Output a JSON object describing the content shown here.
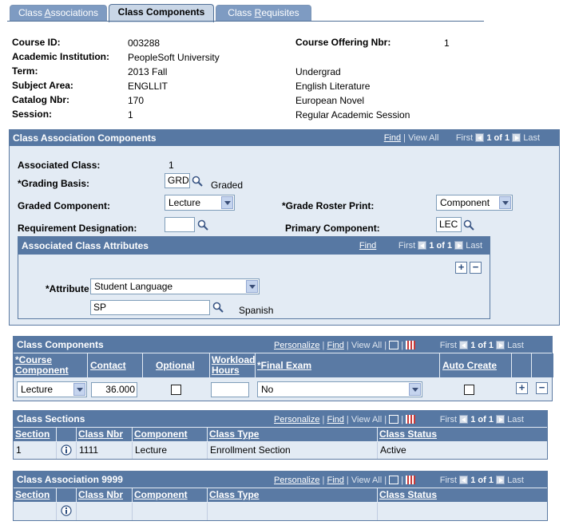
{
  "tabs": [
    {
      "label": "Class ",
      "ul": "A",
      "rest": "ssociations"
    },
    {
      "label": "Class Components"
    },
    {
      "label": "Class ",
      "ul": "R",
      "rest": "equisites"
    }
  ],
  "header": {
    "course_id_label": "Course ID:",
    "course_id": "003288",
    "institution_label": "Academic Institution:",
    "institution": "PeopleSoft University",
    "term_label": "Term:",
    "term": "2013 Fall",
    "career": "Undergrad",
    "subject_label": "Subject Area:",
    "subject": "ENGLLIT",
    "subject_desc": "English Literature",
    "catalog_label": "Catalog Nbr:",
    "catalog": "170",
    "catalog_desc": "European Novel",
    "session_label": "Session:",
    "session": "1",
    "session_desc": "Regular Academic Session",
    "offering_label": "Course Offering Nbr:",
    "offering": "1"
  },
  "nav": {
    "find": "Find",
    "view_all": "View All",
    "first": "First",
    "last": "Last",
    "count": "1 of 1",
    "personalize": "Personalize"
  },
  "assoc": {
    "title": "Class Association Components",
    "assoc_class_label": "Associated Class:",
    "assoc_class": "1",
    "grading_label": "*Grading Basis:",
    "grading_code": "GRD",
    "grading_desc": "Graded",
    "graded_comp_label": "Graded Component:",
    "graded_comp": "Lecture",
    "roster_label": "*Grade Roster Print:",
    "roster": "Component",
    "req_label": "Requirement Designation:",
    "req_value": "",
    "primary_label": "Primary Component:",
    "primary": "LEC",
    "attr": {
      "title": "Associated Class Attributes",
      "attribute_label": "*Attribute",
      "attribute": "Student Language",
      "value": "SP",
      "value_desc": "Spanish"
    }
  },
  "components": {
    "title": "Class Components",
    "headers": [
      "*Course Component",
      "Contact",
      "Optional",
      "Workload Hours",
      "*Final Exam",
      "Auto Create"
    ],
    "row": {
      "component": "Lecture",
      "contact": "36.000",
      "workload": "",
      "final_exam": "No"
    }
  },
  "sections": {
    "title": "Class Sections",
    "headers": [
      "Section",
      "Class Nbr",
      "Component",
      "Class Type",
      "Class Status"
    ],
    "row": {
      "section": "1",
      "class_nbr": "1111",
      "component": "Lecture",
      "class_type": "Enrollment Section",
      "status": "Active"
    }
  },
  "assoc9999": {
    "title": "Class Association 9999",
    "headers": [
      "Section",
      "Class Nbr",
      "Component",
      "Class Type",
      "Class Status"
    ]
  },
  "colors": {
    "header_blue": "#5778a3",
    "panel_bg": "#e3ebf4",
    "tab_inactive": "#7e9bc2"
  }
}
